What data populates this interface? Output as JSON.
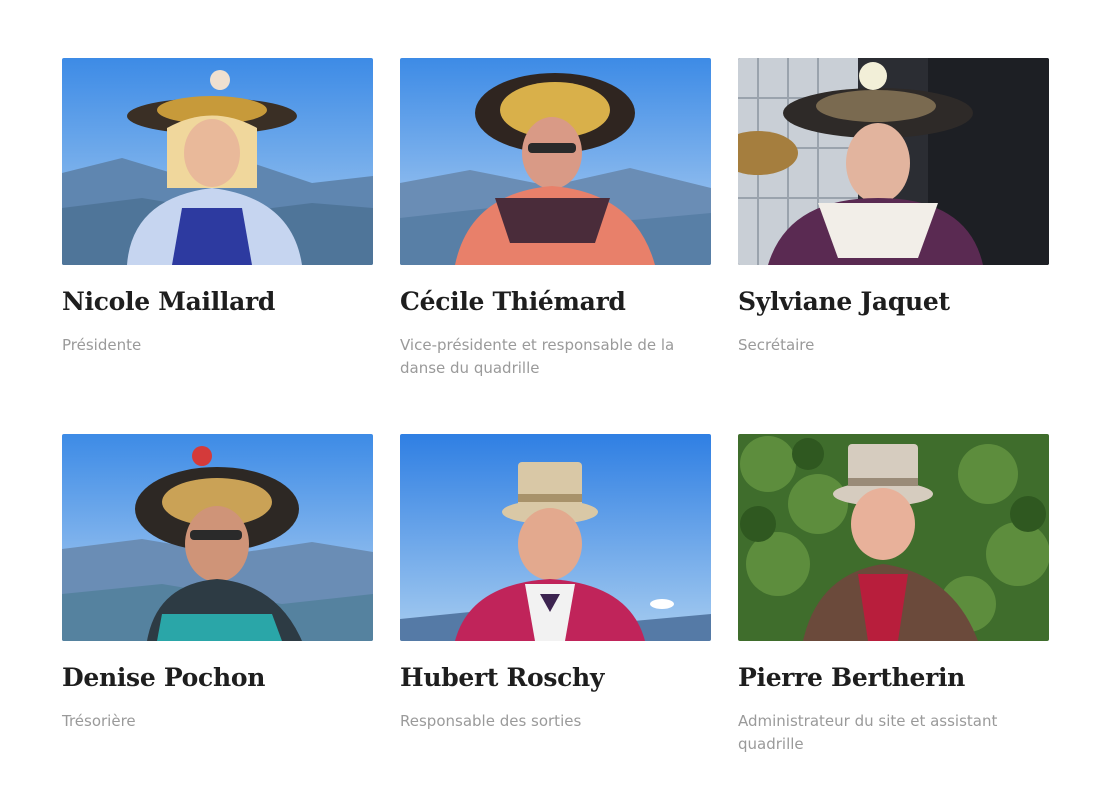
{
  "members": [
    {
      "name": "Nicole Maillard",
      "role": "Présidente",
      "photo_icon": "portrait-photo"
    },
    {
      "name": "Cécile Thiémard",
      "role": "Vice-présidente et responsable de la danse du quadrille",
      "photo_icon": "portrait-photo"
    },
    {
      "name": "Sylviane Jaquet",
      "role": "Secrétaire",
      "photo_icon": "portrait-photo"
    },
    {
      "name": "Denise Pochon",
      "role": "Trésorière",
      "photo_icon": "portrait-photo"
    },
    {
      "name": "Hubert Roschy",
      "role": "Responsable des sorties",
      "photo_icon": "portrait-photo"
    },
    {
      "name": "Pierre Bertherin",
      "role": "Administrateur du site et assistant quadrille",
      "photo_icon": "portrait-photo"
    }
  ],
  "colors": {
    "name_text": "#1e1e1e",
    "role_text": "#9a9a9a",
    "background": "#ffffff"
  }
}
